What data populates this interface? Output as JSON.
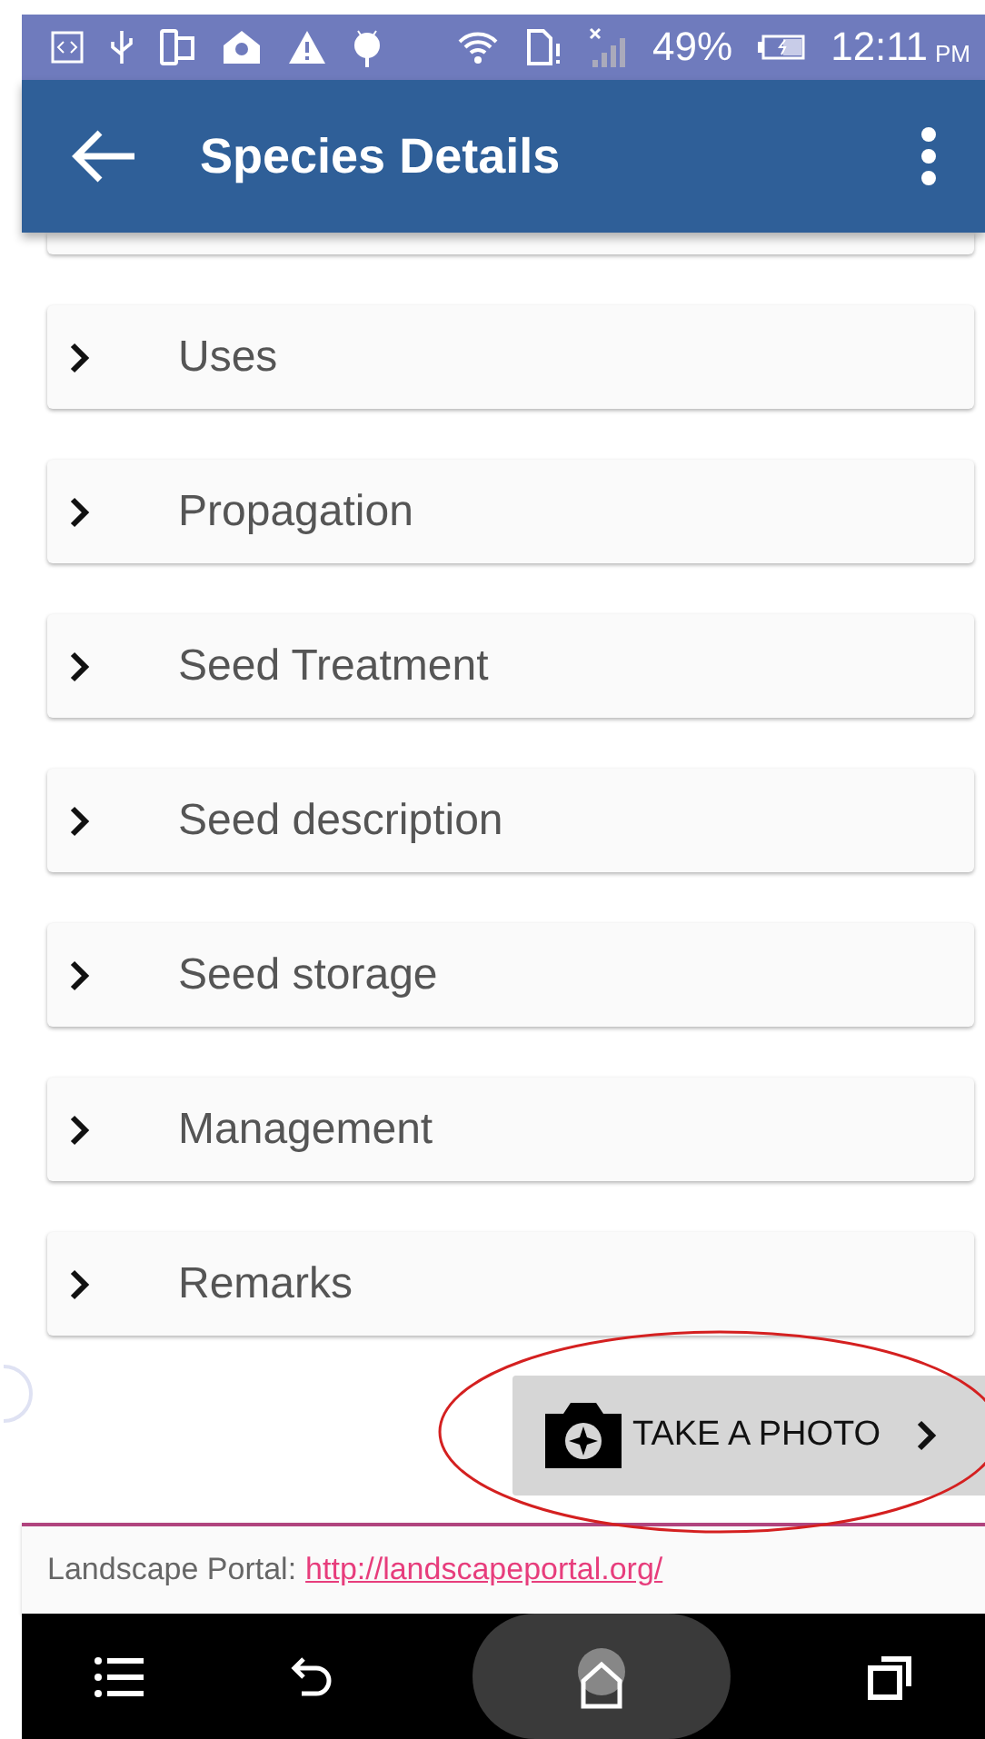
{
  "status_bar": {
    "battery": "49%",
    "time": "12:11",
    "period": "PM"
  },
  "app_bar": {
    "title": "Species Details"
  },
  "sections": [
    {
      "label": "Uses",
      "expanded": false
    },
    {
      "label": "Propagation",
      "expanded": false
    },
    {
      "label": "Seed Treatment",
      "expanded": false
    },
    {
      "label": "Seed description",
      "expanded": false
    },
    {
      "label": "Seed storage",
      "expanded": false
    },
    {
      "label": "Management",
      "expanded": false
    },
    {
      "label": "Remarks",
      "expanded": false
    }
  ],
  "photo_button": {
    "label": "TAKE A PHOTO"
  },
  "footer": {
    "label": "Landscape Portal:",
    "link": "http://landscapeportal.org/"
  }
}
